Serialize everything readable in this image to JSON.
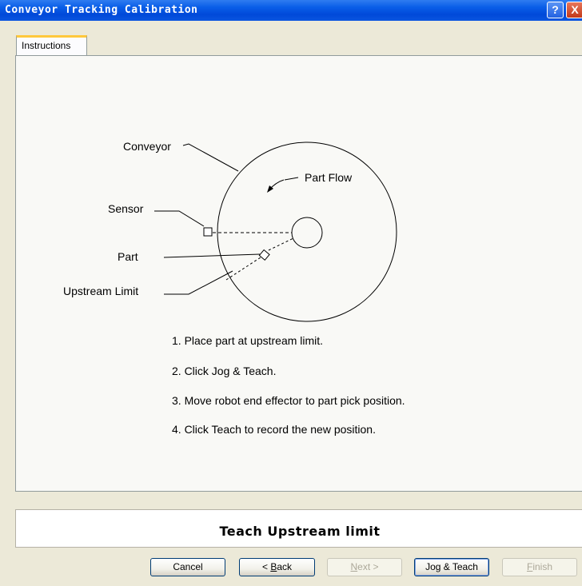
{
  "window": {
    "title": "Conveyor Tracking Calibration",
    "help_glyph": "?",
    "close_glyph": "X"
  },
  "tabs": [
    {
      "label": "Instructions",
      "active": true
    }
  ],
  "diagram": {
    "labels": {
      "conveyor": "Conveyor",
      "part_flow": "Part Flow",
      "sensor": "Sensor",
      "part": "Part",
      "upstream_limit": "Upstream Limit"
    }
  },
  "steps": [
    "1. Place part at upstream limit.",
    "2. Click Jog & Teach.",
    "3. Move robot end effector to part pick position.",
    "4. Click Teach to record the new position."
  ],
  "status": {
    "text": "Teach Upstream limit"
  },
  "buttons": {
    "cancel": {
      "label": "Cancel",
      "enabled": true
    },
    "back": {
      "prefix": "< ",
      "mnemonic": "B",
      "rest": "ack",
      "enabled": true
    },
    "next": {
      "mnemonic": "N",
      "rest": "ext",
      "suffix": " >",
      "enabled": false
    },
    "jog_teach": {
      "label": "Jog & Teach",
      "enabled": true
    },
    "finish": {
      "mnemonic": "F",
      "rest": "inish",
      "enabled": false
    }
  },
  "colors": {
    "titlebar": "#0a5ee8",
    "tab_accent": "#ffc83c",
    "dialog_bg": "#ece9d8"
  }
}
